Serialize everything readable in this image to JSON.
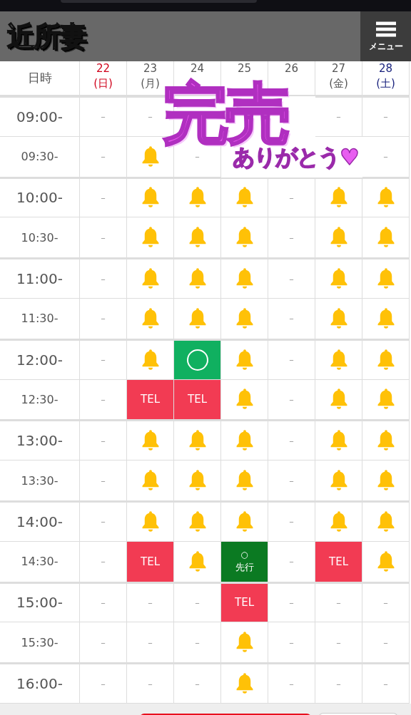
{
  "header": {
    "logo": "近所妻",
    "menu_label": "メニュー"
  },
  "table": {
    "corner": "日時",
    "columns": [
      {
        "day": "22",
        "weekday": "(日)",
        "color": "#d0021b"
      },
      {
        "day": "23",
        "weekday": "(月)",
        "color": "#555555"
      },
      {
        "day": "24",
        "color": "#555555"
      },
      {
        "day": "25",
        "color": "#555555"
      },
      {
        "day": "26",
        "color": "#555555"
      },
      {
        "day": "27",
        "weekday": "(金)",
        "color": "#555555"
      },
      {
        "day": "28",
        "weekday": "(土)",
        "color": "#1a237e"
      }
    ],
    "rows": [
      {
        "time": "09:00-",
        "major": true,
        "cells": [
          {
            "kind": "dash",
            "text": "–"
          },
          {
            "kind": "dash",
            "text": "–"
          },
          {
            "kind": "empty"
          },
          {
            "kind": "empty"
          },
          {
            "kind": "empty"
          },
          {
            "kind": "dash",
            "text": "–"
          },
          {
            "kind": "dash",
            "text": "–"
          }
        ]
      },
      {
        "time": "09:30-",
        "major": false,
        "cells": [
          {
            "kind": "dash",
            "text": "–"
          },
          {
            "kind": "bell"
          },
          {
            "kind": "dash",
            "text": "–"
          },
          {
            "kind": "empty"
          },
          {
            "kind": "empty"
          },
          {
            "kind": "empty"
          },
          {
            "kind": "dash",
            "text": "–"
          }
        ]
      },
      {
        "time": "10:00-",
        "major": true,
        "cells": [
          {
            "kind": "dash",
            "text": "–"
          },
          {
            "kind": "bell"
          },
          {
            "kind": "bell"
          },
          {
            "kind": "bell"
          },
          {
            "kind": "dash",
            "text": "–"
          },
          {
            "kind": "bell"
          },
          {
            "kind": "bell"
          }
        ]
      },
      {
        "time": "10:30-",
        "major": false,
        "cells": [
          {
            "kind": "dash",
            "text": "–"
          },
          {
            "kind": "bell"
          },
          {
            "kind": "bell"
          },
          {
            "kind": "bell"
          },
          {
            "kind": "dash",
            "text": "–"
          },
          {
            "kind": "bell"
          },
          {
            "kind": "bell"
          }
        ]
      },
      {
        "time": "11:00-",
        "major": true,
        "cells": [
          {
            "kind": "dash",
            "text": "–"
          },
          {
            "kind": "bell"
          },
          {
            "kind": "bell"
          },
          {
            "kind": "bell"
          },
          {
            "kind": "dash",
            "text": "–"
          },
          {
            "kind": "bell"
          },
          {
            "kind": "bell"
          }
        ]
      },
      {
        "time": "11:30-",
        "major": false,
        "cells": [
          {
            "kind": "dash",
            "text": "–"
          },
          {
            "kind": "bell"
          },
          {
            "kind": "bell"
          },
          {
            "kind": "bell"
          },
          {
            "kind": "dash",
            "text": "–"
          },
          {
            "kind": "bell"
          },
          {
            "kind": "bell"
          }
        ]
      },
      {
        "time": "12:00-",
        "major": true,
        "cells": [
          {
            "kind": "dash",
            "text": "–"
          },
          {
            "kind": "bell"
          },
          {
            "kind": "circle"
          },
          {
            "kind": "bell"
          },
          {
            "kind": "dash",
            "text": "–"
          },
          {
            "kind": "bell"
          },
          {
            "kind": "bell"
          }
        ]
      },
      {
        "time": "12:30-",
        "major": false,
        "cells": [
          {
            "kind": "dash",
            "text": "–"
          },
          {
            "kind": "tel",
            "text": "TEL"
          },
          {
            "kind": "tel",
            "text": "TEL"
          },
          {
            "kind": "bell"
          },
          {
            "kind": "dash",
            "text": "–"
          },
          {
            "kind": "bell"
          },
          {
            "kind": "bell"
          }
        ]
      },
      {
        "time": "13:00-",
        "major": true,
        "cells": [
          {
            "kind": "dash",
            "text": "–"
          },
          {
            "kind": "bell"
          },
          {
            "kind": "bell"
          },
          {
            "kind": "bell"
          },
          {
            "kind": "dash",
            "text": "–"
          },
          {
            "kind": "bell"
          },
          {
            "kind": "bell"
          }
        ]
      },
      {
        "time": "13:30-",
        "major": false,
        "cells": [
          {
            "kind": "dash",
            "text": "–"
          },
          {
            "kind": "bell"
          },
          {
            "kind": "bell"
          },
          {
            "kind": "bell"
          },
          {
            "kind": "dash",
            "text": "–"
          },
          {
            "kind": "bell"
          },
          {
            "kind": "bell"
          }
        ]
      },
      {
        "time": "14:00-",
        "major": true,
        "cells": [
          {
            "kind": "dash",
            "text": "–"
          },
          {
            "kind": "bell"
          },
          {
            "kind": "bell"
          },
          {
            "kind": "bell"
          },
          {
            "kind": "dash",
            "text": "–"
          },
          {
            "kind": "bell"
          },
          {
            "kind": "bell"
          }
        ]
      },
      {
        "time": "14:30-",
        "major": false,
        "cells": [
          {
            "kind": "dash",
            "text": "–"
          },
          {
            "kind": "tel",
            "text": "TEL"
          },
          {
            "kind": "bell"
          },
          {
            "kind": "advance",
            "mark": "○",
            "text": "先行"
          },
          {
            "kind": "dash",
            "text": "–"
          },
          {
            "kind": "tel",
            "text": "TEL"
          },
          {
            "kind": "bell"
          }
        ]
      },
      {
        "time": "15:00-",
        "major": true,
        "cells": [
          {
            "kind": "dash",
            "text": "–"
          },
          {
            "kind": "dash",
            "text": "–"
          },
          {
            "kind": "dash",
            "text": "–"
          },
          {
            "kind": "tel",
            "text": "TEL"
          },
          {
            "kind": "dash",
            "text": "–"
          },
          {
            "kind": "dash",
            "text": "–"
          },
          {
            "kind": "dash",
            "text": "–"
          }
        ]
      },
      {
        "time": "15:30-",
        "major": false,
        "cells": [
          {
            "kind": "dash",
            "text": "–"
          },
          {
            "kind": "dash",
            "text": "–"
          },
          {
            "kind": "dash",
            "text": "–"
          },
          {
            "kind": "bell"
          },
          {
            "kind": "dash",
            "text": "–"
          },
          {
            "kind": "dash",
            "text": "–"
          },
          {
            "kind": "dash",
            "text": "–"
          }
        ]
      },
      {
        "time": "16:00-",
        "major": true,
        "cells": [
          {
            "kind": "dash",
            "text": "–"
          },
          {
            "kind": "dash",
            "text": "–"
          },
          {
            "kind": "dash",
            "text": "–"
          },
          {
            "kind": "bell"
          },
          {
            "kind": "dash",
            "text": "–"
          },
          {
            "kind": "dash",
            "text": "–"
          },
          {
            "kind": "dash",
            "text": "–"
          }
        ]
      }
    ]
  },
  "banner": {
    "title": "完売",
    "subtitle": "ありがとう♥"
  }
}
